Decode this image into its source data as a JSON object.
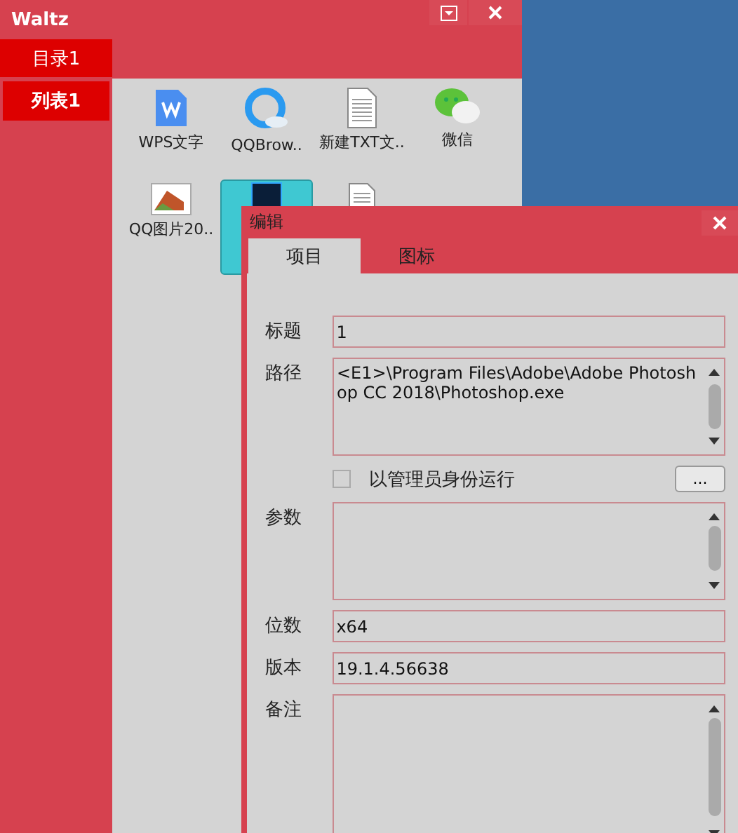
{
  "window": {
    "title": "Waltz"
  },
  "sidebar": {
    "tabs": [
      {
        "label": "目录1",
        "selected": true
      }
    ],
    "items": [
      {
        "label": "列表1",
        "selected": true
      }
    ]
  },
  "desktop_items": [
    {
      "label": "WPS文字",
      "selected": false
    },
    {
      "label": "QQBrow..",
      "selected": false
    },
    {
      "label": "新建TXT文..",
      "selected": false
    },
    {
      "label": "微信",
      "selected": false
    },
    {
      "label": "QQ图片20..",
      "selected": false
    },
    {
      "selected": true
    },
    {
      "selected": false
    }
  ],
  "dialog": {
    "title": "编辑",
    "tabs": [
      {
        "label": "项目",
        "selected": true
      },
      {
        "label": "图标",
        "selected": false
      }
    ],
    "fields": [
      {
        "kind": "line",
        "label": "标题",
        "value": "1"
      },
      {
        "kind": "multiline",
        "label": "路径",
        "value": "<E1>\\Program Files\\Adobe\\Adobe Photoshop CC 2018\\Photoshop.exe"
      },
      {
        "kind": "checkbox",
        "label": "以管理员身份运行",
        "checked": false,
        "button": "..."
      },
      {
        "kind": "multiline",
        "label": "参数"
      },
      {
        "kind": "line",
        "label": "位数",
        "value": "x64"
      },
      {
        "kind": "line",
        "label": "版本",
        "value": "19.1.4.56638"
      },
      {
        "kind": "multiline",
        "label": "备注"
      }
    ]
  }
}
